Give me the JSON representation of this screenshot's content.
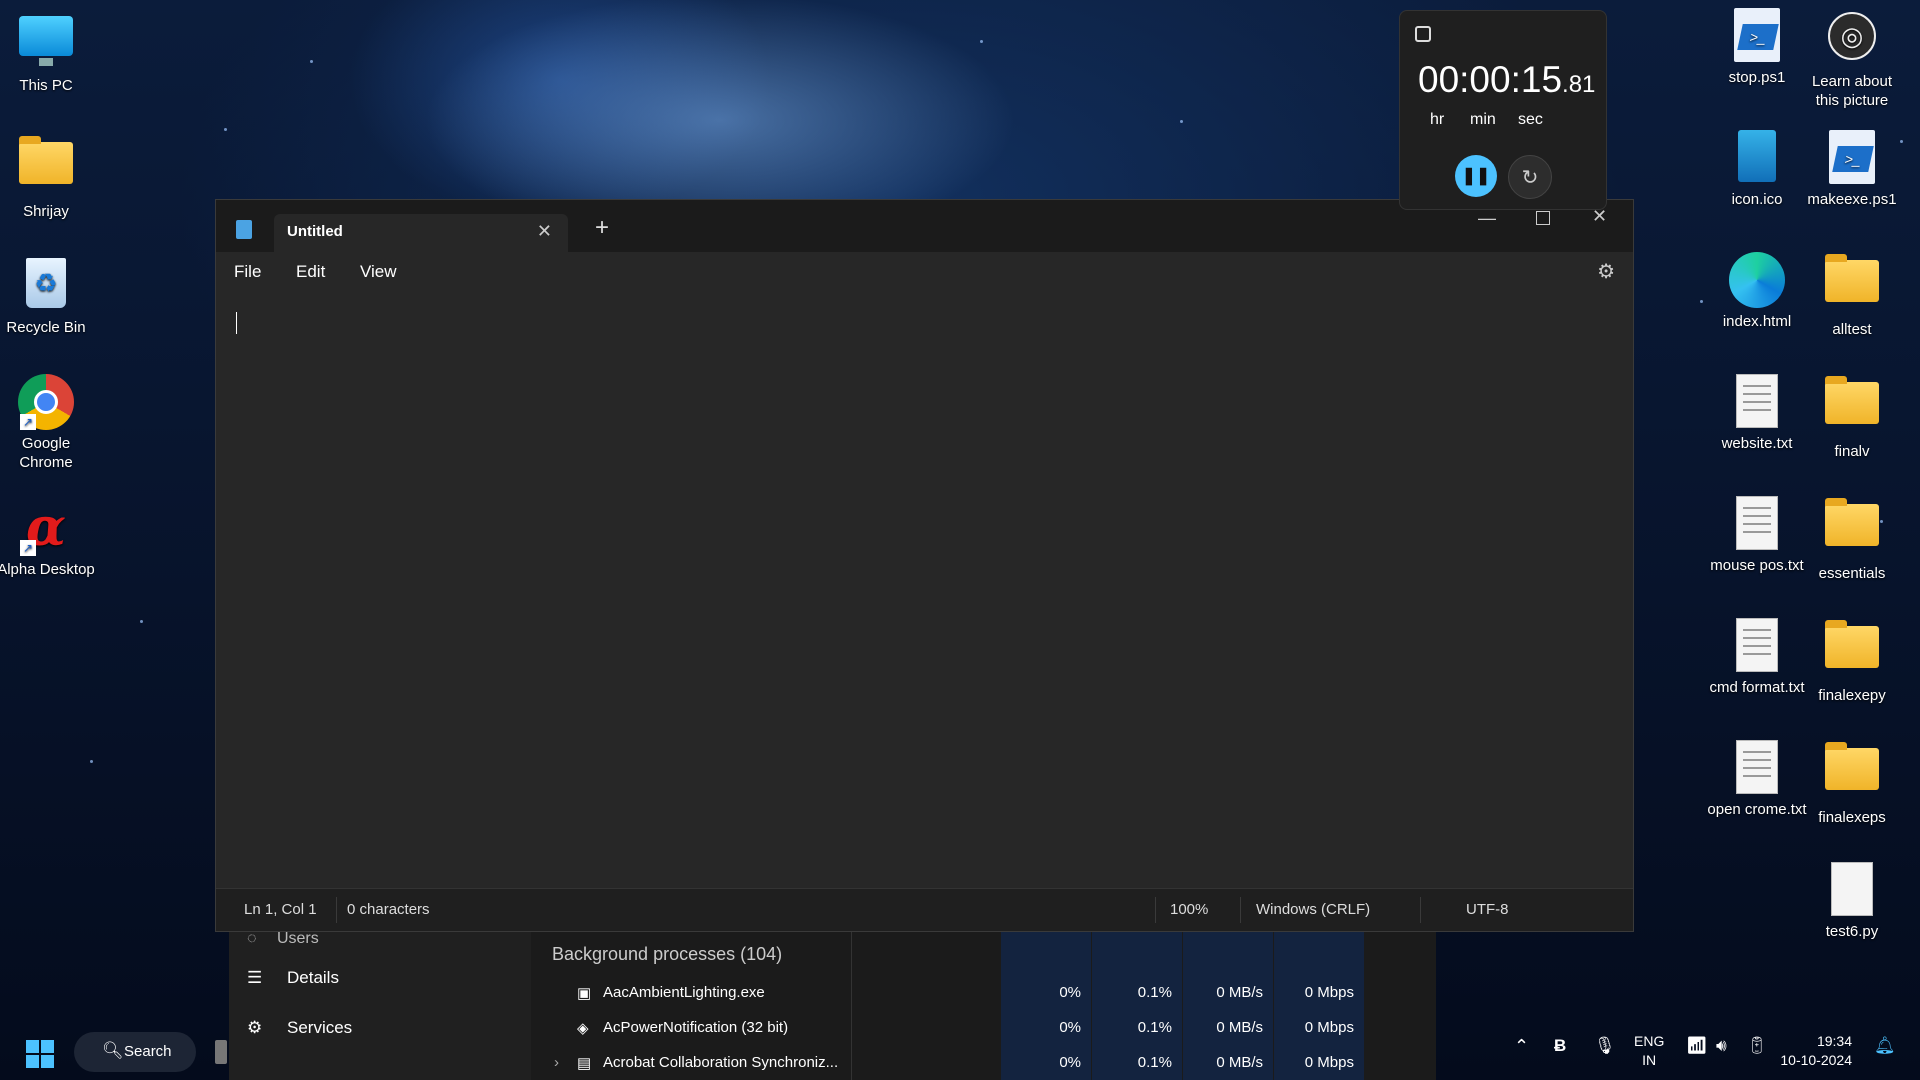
{
  "desktop_left": [
    {
      "label": "This PC",
      "icon": "monitor-icon"
    },
    {
      "label": "Shrijay",
      "icon": "user-folder-icon"
    },
    {
      "label": "Recycle Bin",
      "icon": "recycle-bin-icon"
    },
    {
      "label": "Google Chrome",
      "icon": "chrome-icon"
    },
    {
      "label": "Alpha Desktop",
      "icon": "alpha-icon"
    }
  ],
  "desktop_right": [
    {
      "label": "stop.ps1",
      "icon": "powershell-file-icon"
    },
    {
      "label": "Learn about this picture",
      "icon": "camera-icon"
    },
    {
      "label": "icon.ico",
      "icon": "ico-file-icon"
    },
    {
      "label": "makeexe.ps1",
      "icon": "powershell-file-icon"
    },
    {
      "label": "index.html",
      "icon": "edge-icon"
    },
    {
      "label": "alltest",
      "icon": "folder-icon"
    },
    {
      "label": "website.txt",
      "icon": "text-file-icon"
    },
    {
      "label": "finalv",
      "icon": "folder-icon"
    },
    {
      "label": "mouse pos.txt",
      "icon": "text-file-icon"
    },
    {
      "label": "essentials",
      "icon": "folder-icon"
    },
    {
      "label": "cmd format.txt",
      "icon": "text-file-icon"
    },
    {
      "label": "finalexepy",
      "icon": "folder-icon"
    },
    {
      "label": "open crome.txt",
      "icon": "text-file-icon"
    },
    {
      "label": "finalexeps",
      "icon": "folder-icon"
    },
    {
      "label": "test6.py",
      "icon": "file-icon"
    }
  ],
  "timer": {
    "time_main": "00:00:15",
    "time_frac": ".81",
    "unit_hr": "hr",
    "unit_min": "min",
    "unit_sec": "sec"
  },
  "notepad": {
    "tab_title": "Untitled",
    "menu": [
      "File",
      "Edit",
      "View"
    ],
    "status": {
      "position": "Ln 1, Col 1",
      "characters": "0 characters",
      "zoom": "100%",
      "line_ending": "Windows (CRLF)",
      "encoding": "UTF-8"
    }
  },
  "task_manager": {
    "nav_users": "Users",
    "nav_details": "Details",
    "nav_services": "Services",
    "section_header": "Background processes (104)",
    "processes": [
      {
        "name": "AacAmbientLighting.exe",
        "cpu": "0%",
        "memory": "0.1%",
        "disk": "0 MB/s",
        "network": "0 Mbps"
      },
      {
        "name": "AcPowerNotification (32 bit)",
        "cpu": "0%",
        "memory": "0.1%",
        "disk": "0 MB/s",
        "network": "0 Mbps"
      },
      {
        "name": "Acrobat Collaboration Synchroniz...",
        "cpu": "0%",
        "memory": "0.1%",
        "disk": "0 MB/s",
        "network": "0 Mbps"
      }
    ]
  },
  "taskbar": {
    "search_label": "Search",
    "lang_top": "ENG",
    "lang_bottom": "IN",
    "time": "19:34",
    "date": "10-10-2024"
  }
}
